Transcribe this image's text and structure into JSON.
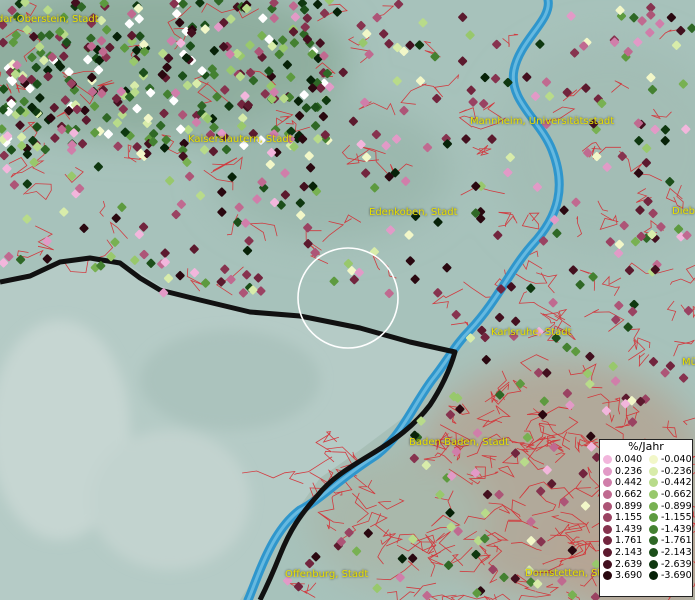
{
  "cities": [
    {
      "name": "Idar-Oberstein, Stadt"
    },
    {
      "name": "Kaiserslautern, Stadt"
    },
    {
      "name": "Mannheim, Universitätsstadt"
    },
    {
      "name": "Edenkoben, Stadt"
    },
    {
      "name": "Karlsruhe, Stadt"
    },
    {
      "name": "Baden-Baden, Stadt"
    },
    {
      "name": "Offenburg, Stadt"
    },
    {
      "name": "Dornstetten, St"
    },
    {
      "name": "Dieb"
    },
    {
      "name": "Mü"
    }
  ],
  "legend": {
    "title": "%/Jahr",
    "positive": [
      {
        "label": "0.040",
        "color": "#f2b6dc"
      },
      {
        "label": "0.236",
        "color": "#e29ac7"
      },
      {
        "label": "0.442",
        "color": "#d07eaa"
      },
      {
        "label": "0.662",
        "color": "#c06a90"
      },
      {
        "label": "0.899",
        "color": "#ad5577"
      },
      {
        "label": "1.155",
        "color": "#9a4262"
      },
      {
        "label": "1.439",
        "color": "#87334f"
      },
      {
        "label": "1.761",
        "color": "#72253e"
      },
      {
        "label": "2.143",
        "color": "#5c1a2e"
      },
      {
        "label": "2.639",
        "color": "#43101f"
      },
      {
        "label": "3.690",
        "color": "#2a0810"
      }
    ],
    "negative": [
      {
        "label": "-0.040",
        "color": "#f2f7c8"
      },
      {
        "label": "-0.236",
        "color": "#d8ecaa"
      },
      {
        "label": "-0.442",
        "color": "#b8db8a"
      },
      {
        "label": "-0.662",
        "color": "#98c86c"
      },
      {
        "label": "-0.899",
        "color": "#78b152"
      },
      {
        "label": "-1.155",
        "color": "#5d9a3f"
      },
      {
        "label": "-1.439",
        "color": "#448131"
      },
      {
        "label": "-1.761",
        "color": "#2f6826"
      },
      {
        "label": "-2.143",
        "color": "#1c4f1a"
      },
      {
        "label": "-2.639",
        "color": "#0f3810"
      },
      {
        "label": "-3.690",
        "color": "#072208"
      }
    ]
  }
}
